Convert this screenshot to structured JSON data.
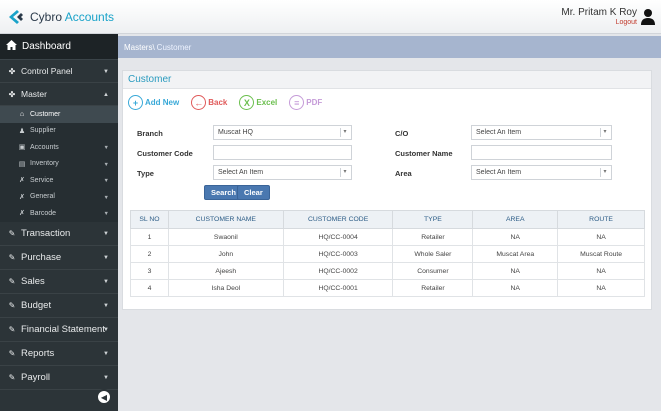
{
  "header": {
    "logo_prefix": "Cybro",
    "logo_accent": "Accounts",
    "user_name": "Mr. Pritam K Roy",
    "logout_label": "Logout"
  },
  "sidebar": {
    "dashboard_label": "Dashboard",
    "items": [
      {
        "label": "Control Panel"
      },
      {
        "label": "Master"
      }
    ],
    "master_sub": [
      {
        "label": "Customer"
      },
      {
        "label": "Supplier"
      },
      {
        "label": "Accounts"
      },
      {
        "label": "Inventory"
      },
      {
        "label": "Service"
      },
      {
        "label": "General"
      },
      {
        "label": "Barcode"
      }
    ],
    "main_items": [
      {
        "label": "Transaction"
      },
      {
        "label": "Purchase"
      },
      {
        "label": "Sales"
      },
      {
        "label": "Budget"
      },
      {
        "label": "Financial Statement"
      },
      {
        "label": "Reports"
      },
      {
        "label": "Payroll"
      }
    ]
  },
  "breadcrumb": {
    "root": "Masters\\",
    "current": "Customer"
  },
  "panel": {
    "title": "Customer"
  },
  "actions": {
    "add": "Add New",
    "back": "Back",
    "excel": "Excel",
    "pdf": "PDF"
  },
  "form": {
    "branch_label": "Branch",
    "branch_value": "Muscat HQ",
    "co_label": "C/O",
    "co_value": "Select An Item",
    "code_label": "Customer Code",
    "code_value": "",
    "name_label": "Customer Name",
    "name_value": "",
    "type_label": "Type",
    "type_value": "Select An Item",
    "area_label": "Area",
    "area_value": "Select An Item",
    "search_label": "Search",
    "clear_label": "Clear"
  },
  "table": {
    "headers": [
      "SL NO",
      "CUSTOMER NAME",
      "CUSTOMER CODE",
      "TYPE",
      "AREA",
      "ROUTE"
    ],
    "rows": [
      [
        "1",
        "Swaonil",
        "HQ/CC-0004",
        "Retailer",
        "NA",
        "NA"
      ],
      [
        "2",
        "John",
        "HQ/CC-0003",
        "Whole Saler",
        "Muscat Area",
        "Muscat Route"
      ],
      [
        "3",
        "Ajeesh",
        "HQ/CC-0002",
        "Consumer",
        "NA",
        "NA"
      ],
      [
        "4",
        "Isha Deol",
        "HQ/CC-0001",
        "Retailer",
        "NA",
        "NA"
      ]
    ]
  },
  "colors": {
    "accent": "#1aa3c9",
    "sidebar": "#2c3438",
    "breadcrumb": "#a6b5cf",
    "button": "#4a78b0"
  }
}
